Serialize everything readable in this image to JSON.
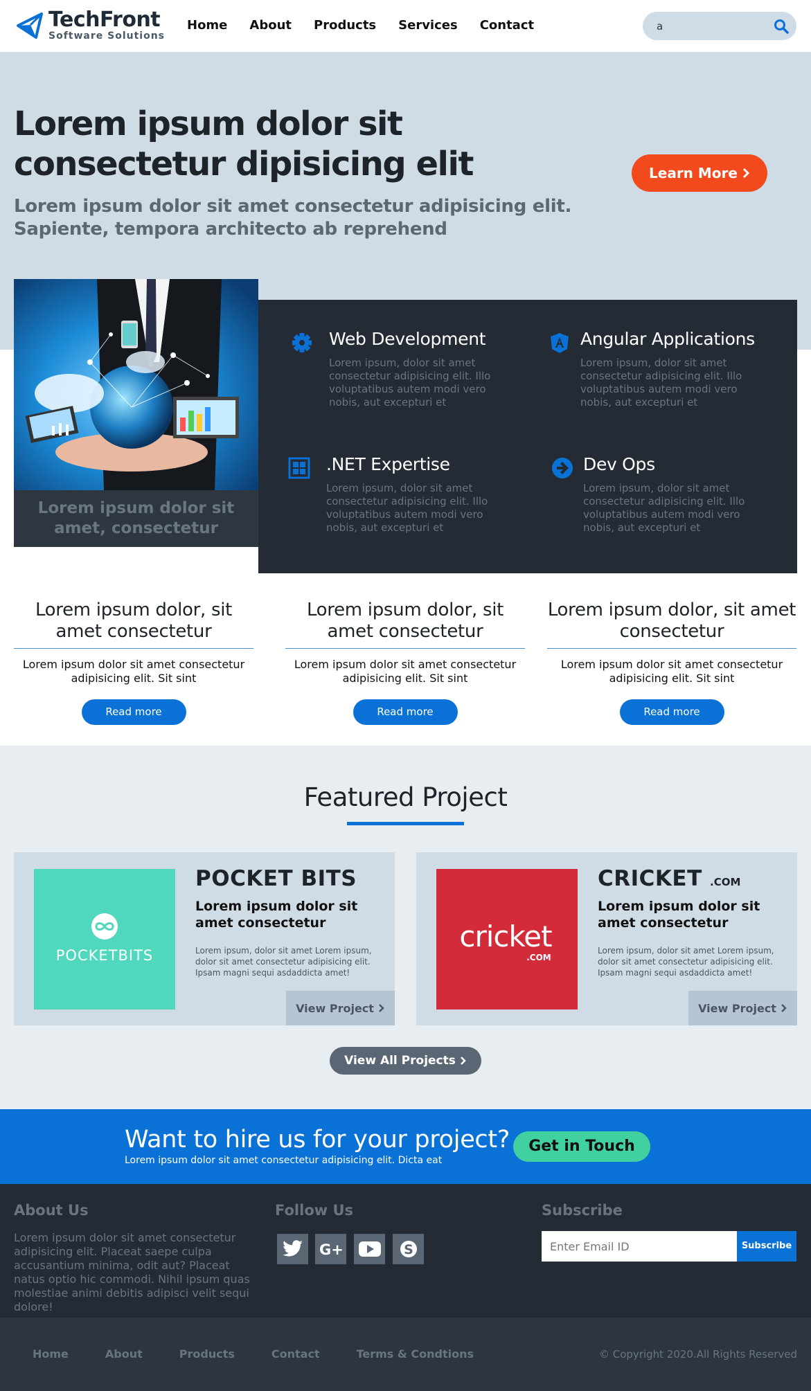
{
  "brand": {
    "name": "TechFront",
    "tagline": "Software Solutions",
    "accent": "#0a72d6"
  },
  "nav": {
    "items": [
      "Home",
      "About",
      "Products",
      "Services",
      "Contact"
    ]
  },
  "search": {
    "value": "a",
    "icon": "search-icon"
  },
  "hero": {
    "title": "Lorem ipsum dolor sit consectetur dipisicing elit",
    "subtitle": "Lorem ipsum dolor sit amet consectetur adipisicing elit. Sapiente, tempora architecto ab reprehend",
    "button": "Learn More"
  },
  "image_card": {
    "caption": "Lorem ipsum dolor sit amet, consectetur"
  },
  "services": [
    {
      "icon": "gear-icon",
      "title": "Web Development",
      "text": "Lorem ipsum, dolor sit amet consectetur adipisicing elit. Illo voluptatibus autem modi vero nobis, aut excepturi et"
    },
    {
      "icon": "angular-icon",
      "title": "Angular Applications",
      "text": "Lorem ipsum, dolor sit amet consectetur adipisicing elit. Illo voluptatibus autem modi vero nobis, aut excepturi et"
    },
    {
      "icon": "windows-icon",
      "title": ".NET Expertise",
      "text": "Lorem ipsum, dolor sit amet consectetur adipisicing elit. Illo voluptatibus autem modi vero nobis, aut excepturi et"
    },
    {
      "icon": "arrow-circle-icon",
      "title": "Dev Ops",
      "text": "Lorem ipsum, dolor sit amet consectetur adipisicing elit. Illo voluptatibus autem modi vero nobis, aut excepturi et"
    }
  ],
  "info": [
    {
      "title": "Lorem ipsum dolor, sit amet consectetur",
      "text": "Lorem ipsum dolor sit amet consectetur adipisicing elit. Sit sint",
      "button": "Read more"
    },
    {
      "title": "Lorem ipsum dolor, sit amet consectetur",
      "text": "Lorem ipsum dolor sit amet consectetur adipisicing elit. Sit sint",
      "button": "Read more"
    },
    {
      "title": "Lorem ipsum dolor, sit amet consectetur",
      "text": "Lorem ipsum dolor sit amet consectetur adipisicing elit. Sit sint",
      "button": "Read more"
    }
  ],
  "featured": {
    "title": "Featured Project",
    "projects": [
      {
        "name": "POCKET BITS",
        "suffix": "",
        "logo_text": "POCKETBITS",
        "heading": "Lorem ipsum dolor sit amet consectetur",
        "text": "Lorem ipsum, dolor sit amet Lorem ipsum, dolor sit amet consectetur adipisicing elit. Ipsam magni sequi asdaddicta amet!",
        "button": "View Project",
        "color": "#4fd8be"
      },
      {
        "name": "CRICKET",
        "suffix": ".COM",
        "logo_text": "cricket",
        "logo_sub": ".COM",
        "heading": "Lorem ipsum dolor sit amet consectetur",
        "text": "Lorem ipsum, dolor sit amet Lorem ipsum, dolor sit amet consectetur adipisicing elit. Ipsam magni sequi asdaddicta amet!",
        "button": "View Project",
        "color": "#d42b3a"
      }
    ],
    "all_button": "View All Projects"
  },
  "cta": {
    "title": "Want to hire us for your project?",
    "subtitle": "Lorem ipsum dolor sit amet consectetur adipisicing elit. Dicta eat",
    "button": "Get in Touch"
  },
  "footer": {
    "about_title": "About Us",
    "about_text": "Lorem ipsum dolor sit amet consectetur adipisicing elit. Placeat saepe culpa accusantium minima, odit aut? Placeat natus optio hic commodi. Nihil ipsum quas molestiae animi debitis adipisci velit sequi dolore!",
    "follow_title": "Follow Us",
    "social": [
      "twitter-icon",
      "google-plus-icon",
      "youtube-icon",
      "skype-icon"
    ],
    "subscribe_title": "Subscribe",
    "email_placeholder": "Enter Email ID",
    "subscribe_button": "Subscribe"
  },
  "bottom": {
    "links": [
      "Home",
      "About",
      "Products",
      "Contact",
      "Terms & Condtions"
    ],
    "copyright": "© Copyright 2020.All Rights Reserved"
  }
}
